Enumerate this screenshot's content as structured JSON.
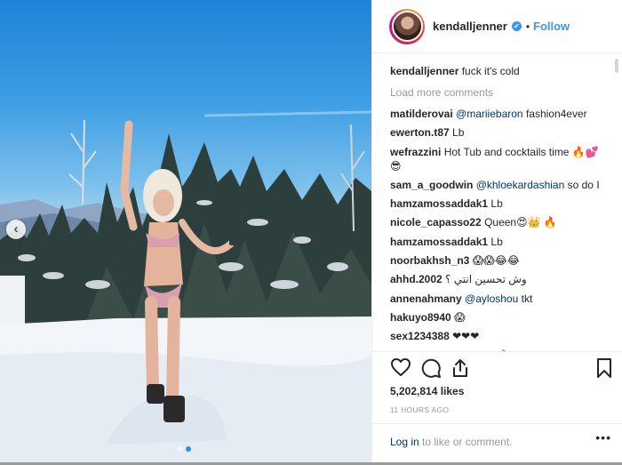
{
  "post": {
    "username": "kendalljenner",
    "verified_glyph": "✔",
    "separator": "•",
    "follow_label": "Follow",
    "caption": "fuck it's cold",
    "load_more_label": "Load more comments",
    "likes": "5,202,814 likes",
    "time_ago": "11 HOURS AGO",
    "login_label": "Log in",
    "login_suffix": "to like or comment.",
    "more_options": "•••"
  },
  "comments": [
    {
      "user": "matilderovai",
      "mention": "@mariiebaron",
      "text": "fashion4ever"
    },
    {
      "user": "ewerton.t87",
      "mention": "",
      "text": "Lb"
    },
    {
      "user": "wefrazzini",
      "mention": "",
      "text": "Hot Tub and cocktails time 🔥💕😎"
    },
    {
      "user": "sam_a_goodwin",
      "mention": "@khloekardashian",
      "text": "so do I"
    },
    {
      "user": "hamzamossaddak1",
      "mention": "",
      "text": "Lb"
    },
    {
      "user": "nicole_capasso22",
      "mention": "",
      "text": "Queen😍👑 🔥"
    },
    {
      "user": "hamzamossaddak1",
      "mention": "",
      "text": "Lb"
    },
    {
      "user": "noorbakhsh_n3",
      "mention": "",
      "text": "😱😱😂😂"
    },
    {
      "user": "ahhd.2002",
      "mention": "",
      "text": "وش تحسين انتي ؟"
    },
    {
      "user": "annenahmany",
      "mention": "@ayloshou",
      "text": "tkt"
    },
    {
      "user": "hakuyo8940",
      "mention": "",
      "text": "😱"
    },
    {
      "user": "sex1234388",
      "mention": "",
      "text": "❤❤❤"
    },
    {
      "user": "unboundedthoughts",
      "mention": "",
      "text": "🔥"
    }
  ],
  "icons": {
    "like": "heart-icon",
    "comment": "comment-icon",
    "share": "share-icon",
    "save": "bookmark-icon",
    "carousel_prev": "chevron-left-icon"
  },
  "carousel": {
    "prev_glyph": "‹",
    "slide_count": 2,
    "active_index": 1
  },
  "colors": {
    "link": "#003569",
    "follow": "#3897f0",
    "muted": "#999999",
    "verified": "#3897f0"
  }
}
